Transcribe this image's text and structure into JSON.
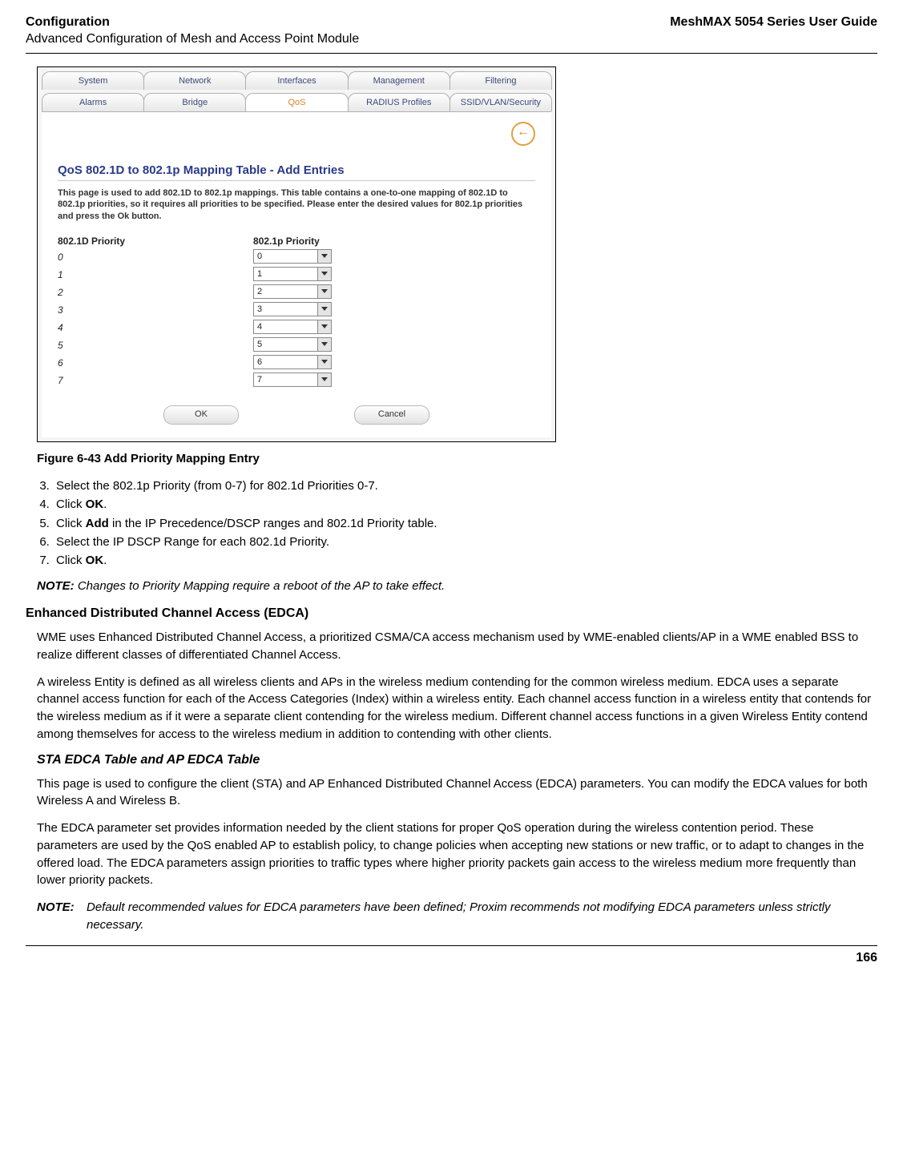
{
  "header": {
    "title": "Configuration",
    "subtitle": "Advanced Configuration of Mesh and Access Point Module",
    "guide": "MeshMAX 5054 Series User Guide"
  },
  "screenshot": {
    "tabs_top": [
      "System",
      "Network",
      "Interfaces",
      "Management",
      "Filtering"
    ],
    "tabs_bottom": [
      "Alarms",
      "Bridge",
      "QoS",
      "RADIUS Profiles",
      "SSID/VLAN/Security"
    ],
    "active_tab": "QoS",
    "back_glyph": "←",
    "section_title": "QoS 802.1D to 802.1p Mapping Table - Add Entries",
    "description": "This page is used to add 802.1D to 802.1p mappings. This table contains a one-to-one mapping of 802.1D to 802.1p priorities, so it requires all priorities to be specified. Please enter the desired values for 802.1p priorities and press the Ok button.",
    "col1_head": "802.1D Priority",
    "col2_head": "802.1p Priority",
    "rows": [
      {
        "d": "0",
        "p": "0"
      },
      {
        "d": "1",
        "p": "1"
      },
      {
        "d": "2",
        "p": "2"
      },
      {
        "d": "3",
        "p": "3"
      },
      {
        "d": "4",
        "p": "4"
      },
      {
        "d": "5",
        "p": "5"
      },
      {
        "d": "6",
        "p": "6"
      },
      {
        "d": "7",
        "p": "7"
      }
    ],
    "ok_label": "OK",
    "cancel_label": "Cancel"
  },
  "figure_caption": "Figure 6-43 Add Priority Mapping Entry",
  "steps": {
    "s3": "Select the 802.1p Priority (from 0-7) for 802.1d Priorities 0-7.",
    "s4_a": "Click ",
    "s4_b": "OK",
    "s4_c": ".",
    "s5_a": "Click ",
    "s5_b": "Add",
    "s5_c": " in the IP Precedence/DSCP ranges and 802.1d Priority table.",
    "s6": "Select the IP DSCP Range for each 802.1d Priority.",
    "s7_a": "Click ",
    "s7_b": "OK",
    "s7_c": "."
  },
  "note1_label": "NOTE:",
  "note1_text": "Changes to Priority Mapping require a reboot of the AP to take effect.",
  "edca_heading": "Enhanced Distributed Channel Access (EDCA)",
  "edca_p1": "WME uses Enhanced Distributed Channel Access, a prioritized CSMA/CA access mechanism used by WME-enabled clients/AP in a WME enabled BSS to realize different classes of differentiated Channel Access.",
  "edca_p2": "A wireless Entity is defined as all wireless clients and APs in the wireless medium contending for the common wireless medium. EDCA uses a separate channel access function for each of the Access Categories (Index) within a wireless entity. Each channel access function in a wireless entity that contends for the wireless medium as if it were a separate client contending for the wireless medium. Different channel access functions in a given Wireless Entity contend among themselves for access to the wireless medium in addition to contending with other clients.",
  "sub_heading": "STA EDCA Table and AP EDCA Table",
  "sub_p1": "This page is used to configure the client (STA) and AP Enhanced Distributed Channel Access (EDCA) parameters. You can modify the EDCA values for both Wireless A and Wireless B.",
  "sub_p2": "The EDCA parameter set provides information needed by the client stations for proper QoS operation during the wireless contention period. These parameters are used by the QoS enabled AP to establish policy, to change policies when accepting new stations or new traffic, or to adapt to changes in the offered load. The EDCA parameters assign priorities to traffic types where higher priority packets gain access to the wireless medium more frequently than lower priority packets.",
  "note2_label": "NOTE:",
  "note2_text": "Default recommended values for EDCA parameters have been defined; Proxim recommends not modifying EDCA parameters unless strictly necessary.",
  "page_number": "166"
}
